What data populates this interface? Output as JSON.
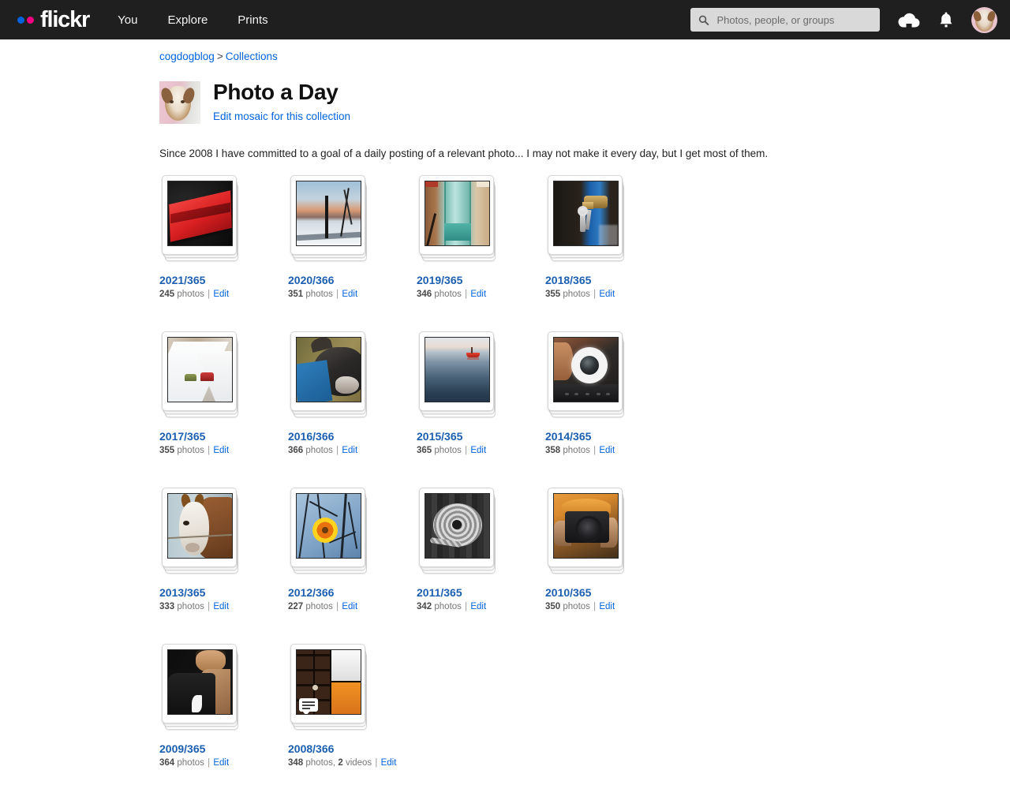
{
  "header": {
    "logo_text": "flickr",
    "nav": [
      {
        "label": "You"
      },
      {
        "label": "Explore"
      },
      {
        "label": "Prints"
      }
    ],
    "search": {
      "placeholder": "Photos, people, or groups",
      "value": ""
    },
    "icons": {
      "search": "search-icon",
      "upload": "cloud-upload-icon",
      "notifications": "bell-icon",
      "avatar": "user-avatar"
    },
    "colors": {
      "background": "#1f1f1f",
      "logo_blue": "#0063dc",
      "logo_pink": "#ff0084"
    }
  },
  "breadcrumb": {
    "user": "cogdogblog",
    "separator": ">",
    "section": "Collections"
  },
  "collection": {
    "title": "Photo a Day",
    "edit_link": "Edit mosaic for this collection",
    "description": "Since 2008 I have committed to a goal of a daily posting of a relevant photo... I may not make it every day, but I get most of them."
  },
  "meta_labels": {
    "photos": "photos",
    "videos": "videos",
    "edit": "Edit",
    "separator": "|"
  },
  "albums": [
    {
      "title": "2021/365",
      "count": "245",
      "unit": "photos",
      "extra": "",
      "edit": "Edit",
      "art": "art-red"
    },
    {
      "title": "2020/366",
      "count": "351",
      "unit": "photos",
      "extra": "",
      "edit": "Edit",
      "art": "art-winter"
    },
    {
      "title": "2019/365",
      "count": "346",
      "unit": "photos",
      "extra": "",
      "edit": "Edit",
      "art": "art-glass"
    },
    {
      "title": "2018/365",
      "count": "355",
      "unit": "photos",
      "extra": "",
      "edit": "Edit",
      "art": "art-keys"
    },
    {
      "title": "2017/365",
      "count": "355",
      "unit": "photos",
      "extra": "",
      "edit": "Edit",
      "art": "art-cars"
    },
    {
      "title": "2016/366",
      "count": "366",
      "unit": "photos",
      "extra": "",
      "edit": "Edit",
      "art": "art-goat"
    },
    {
      "title": "2015/365",
      "count": "365",
      "unit": "photos",
      "extra": "",
      "edit": "Edit",
      "art": "art-sea"
    },
    {
      "title": "2014/365",
      "count": "358",
      "unit": "photos",
      "extra": "",
      "edit": "Edit",
      "art": "art-lens"
    },
    {
      "title": "2013/365",
      "count": "333",
      "unit": "photos",
      "extra": "",
      "edit": "Edit",
      "art": "art-horse"
    },
    {
      "title": "2012/366",
      "count": "227",
      "unit": "photos",
      "extra": "",
      "edit": "Edit",
      "art": "art-branch"
    },
    {
      "title": "2011/365",
      "count": "342",
      "unit": "photos",
      "extra": "",
      "edit": "Edit",
      "art": "art-rope"
    },
    {
      "title": "2010/365",
      "count": "350",
      "unit": "photos",
      "extra": "",
      "edit": "Edit",
      "art": "art-cam"
    },
    {
      "title": "2009/365",
      "count": "364",
      "unit": "photos",
      "extra": "",
      "edit": "Edit",
      "art": "art-man"
    },
    {
      "title": "2008/366",
      "count": "348",
      "unit": "photos,",
      "extra": "2 videos",
      "edit": "Edit",
      "art": "art-shelf"
    }
  ]
}
